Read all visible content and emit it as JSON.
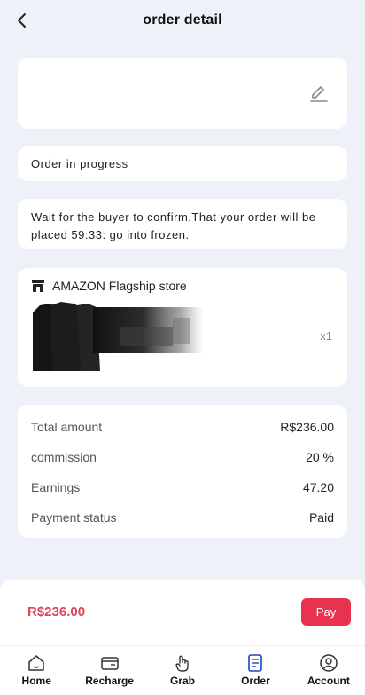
{
  "header": {
    "title": "order detail"
  },
  "status": {
    "text": "Order in progress"
  },
  "notice": {
    "text": "Wait for the buyer to confirm.That your order will be placed 59:33: go into frozen."
  },
  "product": {
    "store_name": "AMAZON Flagship store",
    "quantity": "x1"
  },
  "summary": {
    "rows": [
      {
        "label": "Total amount",
        "value": "R$236.00"
      },
      {
        "label": "commission",
        "value": "20 %"
      },
      {
        "label": "Earnings",
        "value": "47.20"
      },
      {
        "label": "Payment status",
        "value": "Paid"
      }
    ]
  },
  "pay": {
    "amount": "R$236.00",
    "button_label": "Pay"
  },
  "tabbar": {
    "items": [
      {
        "label": "Home",
        "icon": "home-icon"
      },
      {
        "label": "Recharge",
        "icon": "wallet-icon"
      },
      {
        "label": "Grab",
        "icon": "hand-icon"
      },
      {
        "label": "Order",
        "icon": "document-icon"
      },
      {
        "label": "Account",
        "icon": "user-icon"
      }
    ]
  },
  "colors": {
    "accent": "#e8324f",
    "price": "#e0435a",
    "background": "#eef1f8"
  }
}
